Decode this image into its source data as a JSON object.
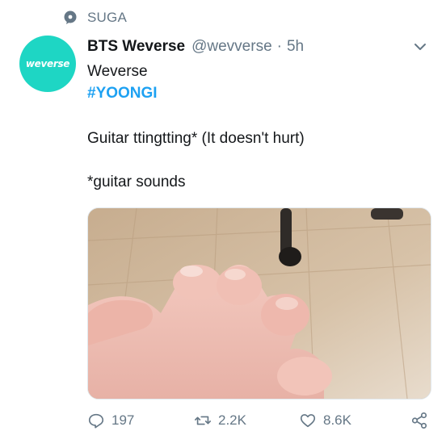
{
  "topic": {
    "icon": "topic-bubble-icon",
    "label": "SUGA"
  },
  "avatar": {
    "text": "weverse",
    "color": "#1ed6c4"
  },
  "tweet": {
    "display_name": "BTS Weverse",
    "handle": "@wevverse",
    "separator": "·",
    "time": "5h",
    "line1": "Weverse",
    "hashtag": "#YOONGI",
    "line2": "Guitar ttingtting* (It doesn't hurt)",
    "line3": "*guitar sounds"
  },
  "actions": {
    "reply_count": "197",
    "retweet_count": "2.2K",
    "like_count": "8.6K"
  },
  "colors": {
    "link": "#1da1f2",
    "muted": "#657786",
    "text": "#14171a"
  }
}
